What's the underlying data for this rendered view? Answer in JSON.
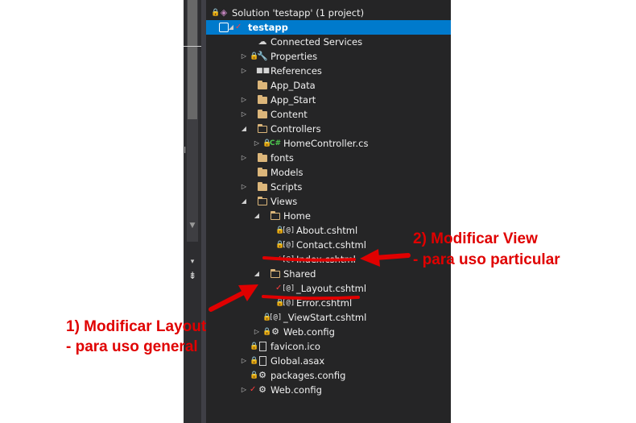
{
  "tree": {
    "rows": [
      {
        "label": "Solution 'testapp' (1 project)",
        "indent": 0,
        "expander": "",
        "lock": true,
        "check": false,
        "icon": "solution-icon",
        "kind": "solution"
      },
      {
        "label": "testapp",
        "indent": 0,
        "expander": "◢",
        "lock": false,
        "check": true,
        "icon": "web-project-icon",
        "kind": "project",
        "selected": true
      },
      {
        "label": "Connected Services",
        "indent": 1,
        "expander": "",
        "lock": false,
        "check": false,
        "icon": "cloud-icon",
        "kind": "cloud"
      },
      {
        "label": "Properties",
        "indent": 1,
        "expander": "▷",
        "lock": true,
        "check": false,
        "icon": "wrench-icon",
        "kind": "wrench"
      },
      {
        "label": "References",
        "indent": 1,
        "expander": "▷",
        "lock": false,
        "check": false,
        "icon": "references-icon",
        "kind": "refs"
      },
      {
        "label": "App_Data",
        "indent": 1,
        "expander": "",
        "lock": false,
        "check": false,
        "icon": "folder-icon",
        "kind": "folder"
      },
      {
        "label": "App_Start",
        "indent": 1,
        "expander": "▷",
        "lock": false,
        "check": false,
        "icon": "folder-icon",
        "kind": "folder"
      },
      {
        "label": "Content",
        "indent": 1,
        "expander": "▷",
        "lock": false,
        "check": false,
        "icon": "folder-icon",
        "kind": "folder"
      },
      {
        "label": "Controllers",
        "indent": 1,
        "expander": "◢",
        "lock": false,
        "check": false,
        "icon": "folder-open-icon",
        "kind": "folder-open"
      },
      {
        "label": "HomeController.cs",
        "indent": 2,
        "expander": "▷",
        "lock": true,
        "check": false,
        "icon": "csharp-file-icon",
        "kind": "csharp"
      },
      {
        "label": "fonts",
        "indent": 1,
        "expander": "▷",
        "lock": false,
        "check": false,
        "icon": "folder-icon",
        "kind": "folder"
      },
      {
        "label": "Models",
        "indent": 1,
        "expander": "",
        "lock": false,
        "check": false,
        "icon": "folder-icon",
        "kind": "folder"
      },
      {
        "label": "Scripts",
        "indent": 1,
        "expander": "▷",
        "lock": false,
        "check": false,
        "icon": "folder-icon",
        "kind": "folder"
      },
      {
        "label": "Views",
        "indent": 1,
        "expander": "◢",
        "lock": false,
        "check": false,
        "icon": "folder-open-icon",
        "kind": "folder-open"
      },
      {
        "label": "Home",
        "indent": 2,
        "expander": "◢",
        "lock": false,
        "check": false,
        "icon": "folder-open-icon",
        "kind": "folder-open"
      },
      {
        "label": "About.cshtml",
        "indent": 3,
        "expander": "",
        "lock": true,
        "check": false,
        "icon": "razor-file-icon",
        "kind": "razor"
      },
      {
        "label": "Contact.cshtml",
        "indent": 3,
        "expander": "",
        "lock": true,
        "check": false,
        "icon": "razor-file-icon",
        "kind": "razor"
      },
      {
        "label": "Index.cshtml",
        "indent": 3,
        "expander": "",
        "lock": false,
        "check": true,
        "icon": "razor-file-icon",
        "kind": "razor"
      },
      {
        "label": "Shared",
        "indent": 2,
        "expander": "◢",
        "lock": false,
        "check": false,
        "icon": "folder-open-icon",
        "kind": "folder-open"
      },
      {
        "label": "_Layout.cshtml",
        "indent": 3,
        "expander": "",
        "lock": false,
        "check": true,
        "icon": "razor-file-icon",
        "kind": "razor"
      },
      {
        "label": "Error.cshtml",
        "indent": 3,
        "expander": "",
        "lock": true,
        "check": false,
        "icon": "razor-file-icon",
        "kind": "razor"
      },
      {
        "label": "_ViewStart.cshtml",
        "indent": 2,
        "expander": "",
        "lock": true,
        "check": false,
        "icon": "razor-file-icon",
        "kind": "razor"
      },
      {
        "label": "Web.config",
        "indent": 2,
        "expander": "▷",
        "lock": true,
        "check": false,
        "icon": "config-file-icon",
        "kind": "config"
      },
      {
        "label": "favicon.ico",
        "indent": 1,
        "expander": "",
        "lock": true,
        "check": false,
        "icon": "image-file-icon",
        "kind": "doc"
      },
      {
        "label": "Global.asax",
        "indent": 1,
        "expander": "▷",
        "lock": true,
        "check": false,
        "icon": "asax-file-icon",
        "kind": "doc"
      },
      {
        "label": "packages.config",
        "indent": 1,
        "expander": "",
        "lock": true,
        "check": false,
        "icon": "config-file-icon",
        "kind": "config"
      },
      {
        "label": "Web.config",
        "indent": 1,
        "expander": "▷",
        "lock": false,
        "check": true,
        "icon": "config-file-icon",
        "kind": "config"
      }
    ]
  },
  "annotations": {
    "view_line1": "2) Modificar View",
    "view_line2": "- para uso particular",
    "layout_line1": "1) Modificar Layout",
    "layout_line2": "- para uso general"
  },
  "colors": {
    "panel_bg": "#252526",
    "selection": "#007acc",
    "annotation": "#e00000",
    "lock": "#3794ff",
    "checkout": "#ff3b3b"
  }
}
